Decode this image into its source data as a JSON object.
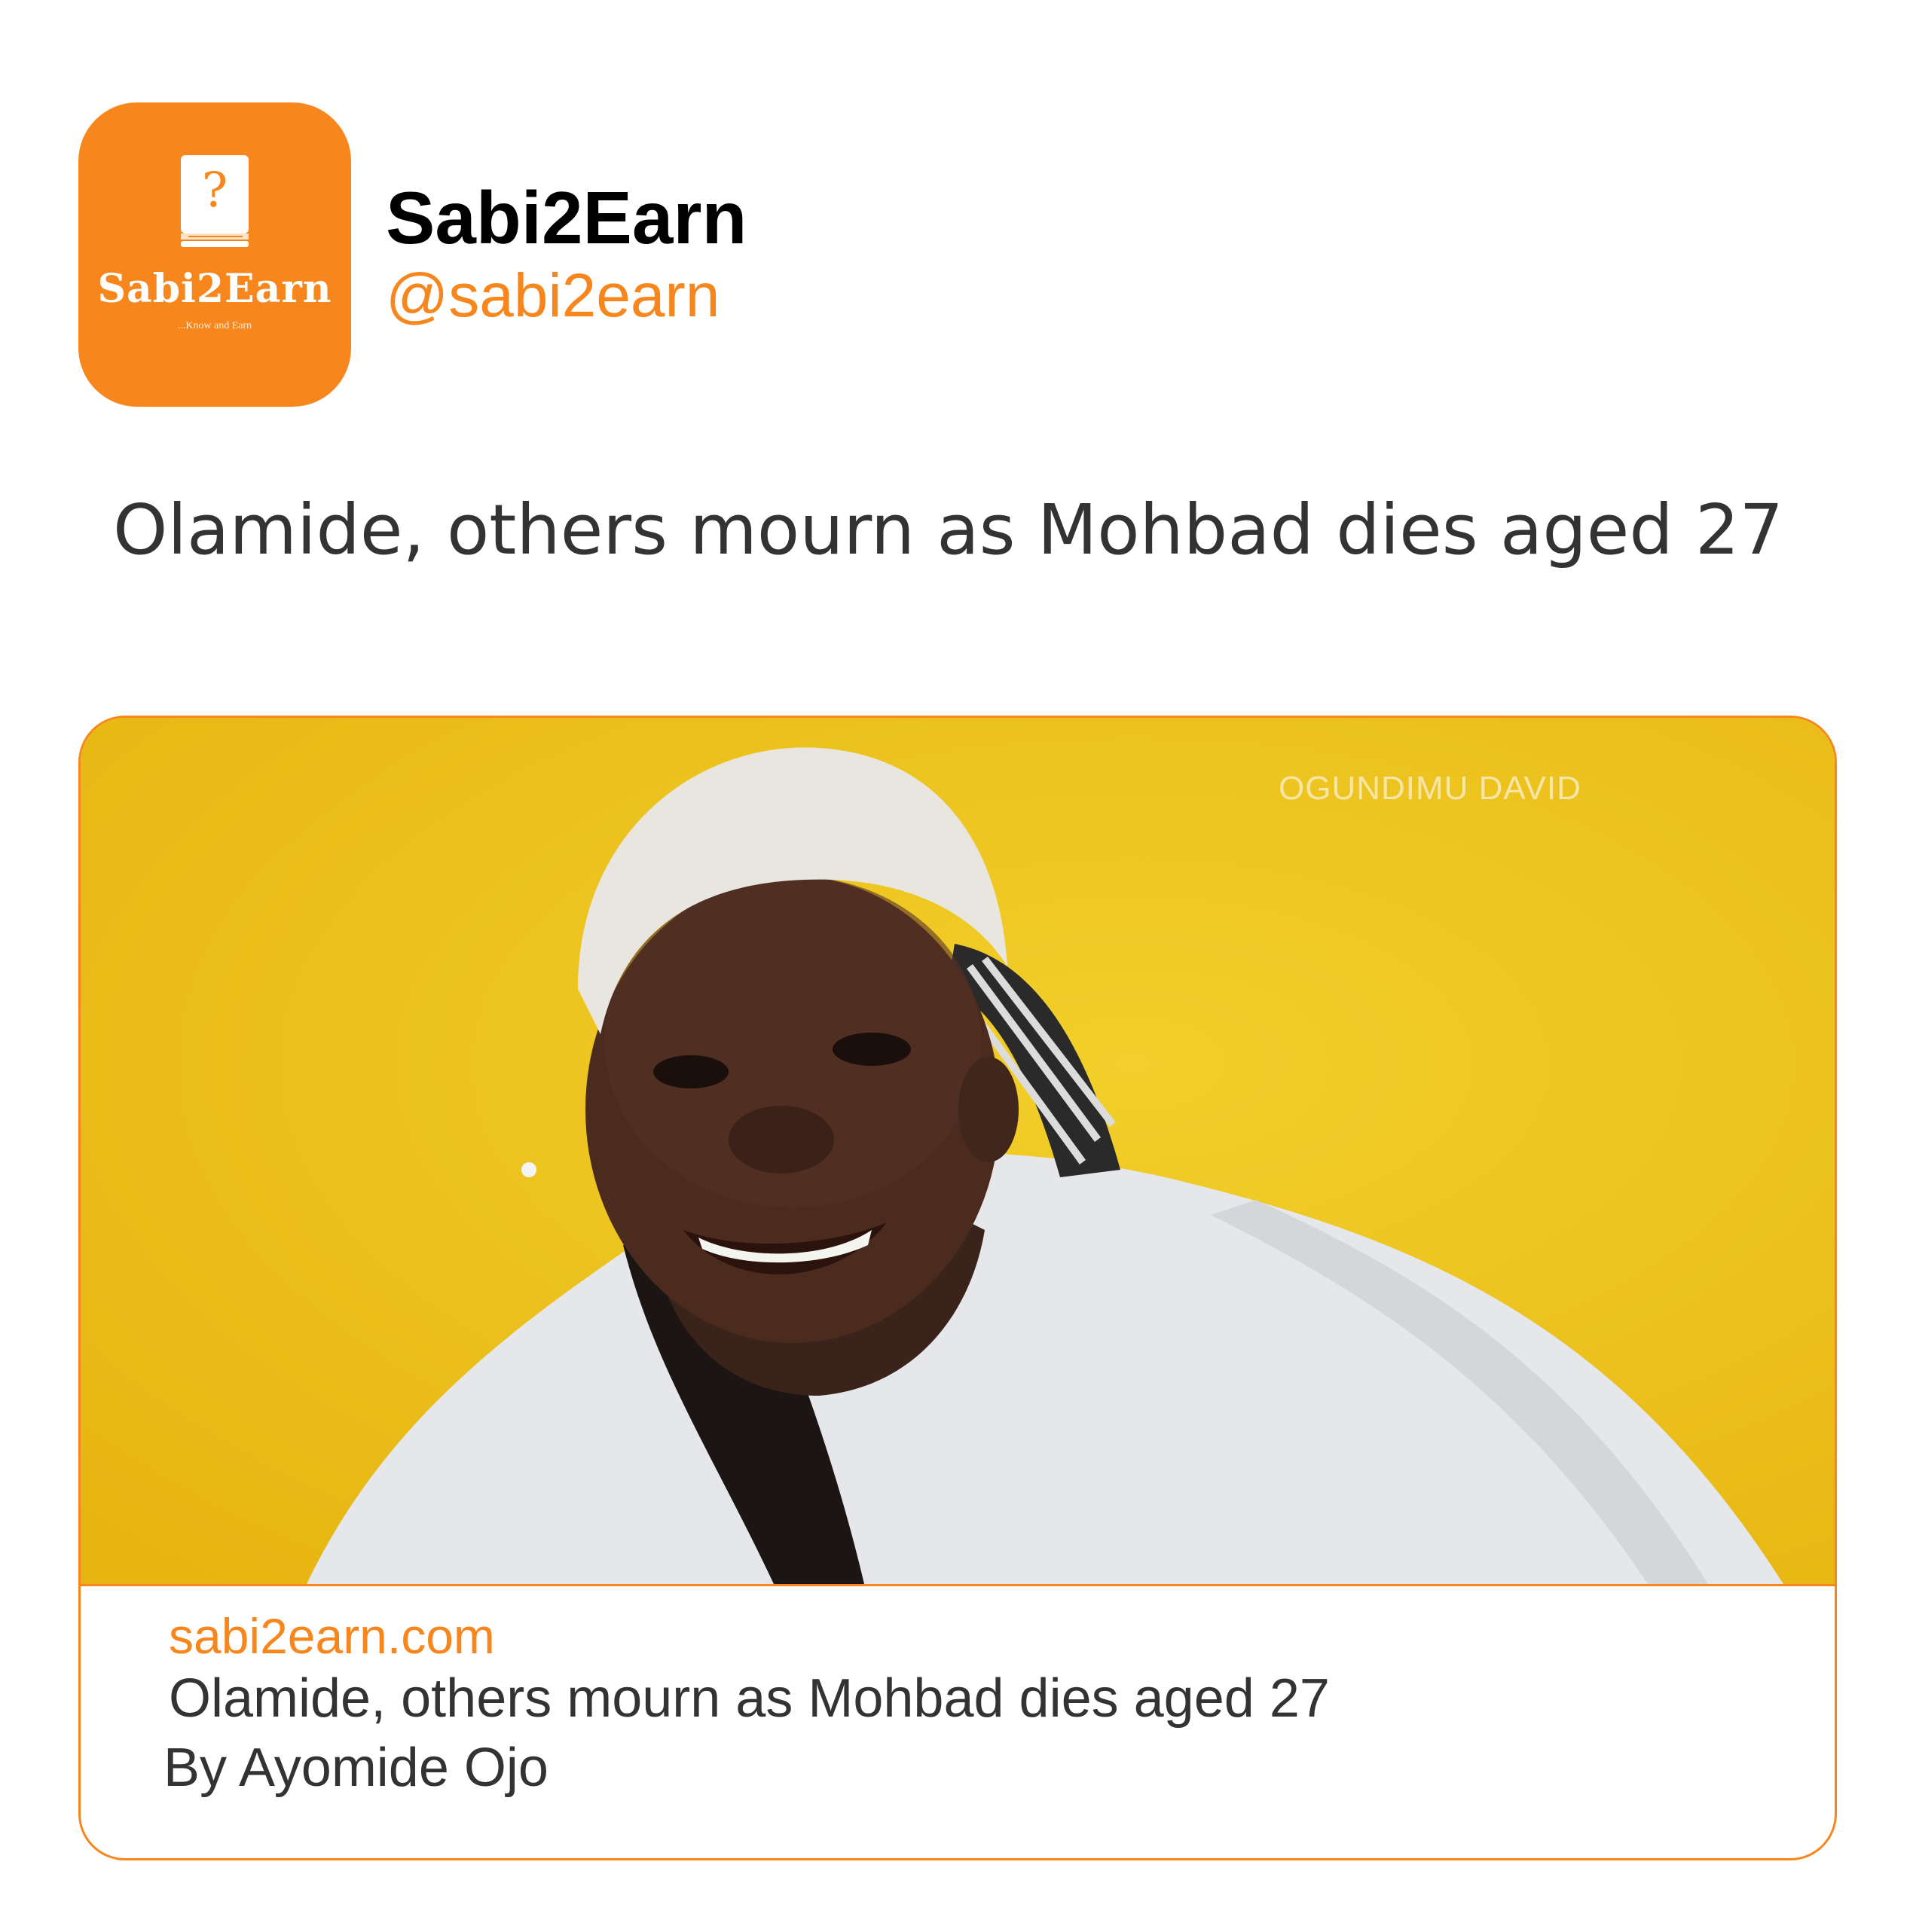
{
  "account": {
    "name": "Sabi2Earn",
    "handle": "@sabi2earn",
    "avatar": {
      "icon": "question-book-icon",
      "brand_text": "Sabi2Earn",
      "tagline": "...Know and Earn"
    }
  },
  "post": {
    "text": "Olamide, others mourn as Mohbad dies aged 27"
  },
  "link_card": {
    "image": {
      "description_icon": "news-photo",
      "watermark": "OGUNDIMU DAVID"
    },
    "domain": "sabi2earn.com",
    "title": "Olamide, others mourn as Mohbad dies aged 27",
    "author": "By Ayomide Ojo"
  },
  "colors": {
    "accent": "#f7871c",
    "text": "#333333",
    "background": "#ffffff",
    "image_background": "#f0c51e"
  }
}
